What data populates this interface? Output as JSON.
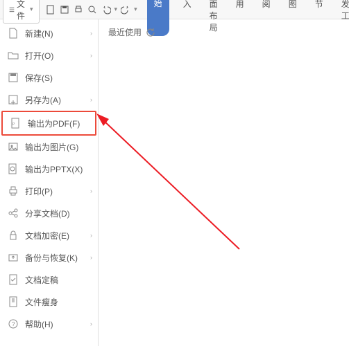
{
  "fileButton": {
    "label": "文件"
  },
  "tabs": [
    {
      "label": "开始",
      "active": true
    },
    {
      "label": "插入"
    },
    {
      "label": "页面布局"
    },
    {
      "label": "引用"
    },
    {
      "label": "审阅"
    },
    {
      "label": "视图"
    },
    {
      "label": "章节"
    },
    {
      "label": "开发工"
    }
  ],
  "menu": [
    {
      "label": "新建(N)",
      "arrow": true,
      "icon": "doc"
    },
    {
      "label": "打开(O)",
      "arrow": true,
      "icon": "folder"
    },
    {
      "label": "保存(S)",
      "arrow": false,
      "icon": "save"
    },
    {
      "label": "另存为(A)",
      "arrow": true,
      "icon": "saveas"
    },
    {
      "label": "输出为PDF(F)",
      "arrow": false,
      "icon": "pdf",
      "highlight": true
    },
    {
      "label": "输出为图片(G)",
      "arrow": false,
      "icon": "image"
    },
    {
      "label": "输出为PPTX(X)",
      "arrow": false,
      "icon": "pptx"
    },
    {
      "label": "打印(P)",
      "arrow": true,
      "icon": "print"
    },
    {
      "label": "分享文档(D)",
      "arrow": false,
      "icon": "share"
    },
    {
      "label": "文档加密(E)",
      "arrow": true,
      "icon": "lock"
    },
    {
      "label": "备份与恢复(K)",
      "arrow": true,
      "icon": "backup"
    },
    {
      "label": "文档定稿",
      "arrow": false,
      "icon": "finalize"
    },
    {
      "label": "文件瘦身",
      "arrow": false,
      "icon": "compress"
    },
    {
      "label": "帮助(H)",
      "arrow": true,
      "icon": "help"
    }
  ],
  "recent": {
    "label": "最近使用"
  }
}
